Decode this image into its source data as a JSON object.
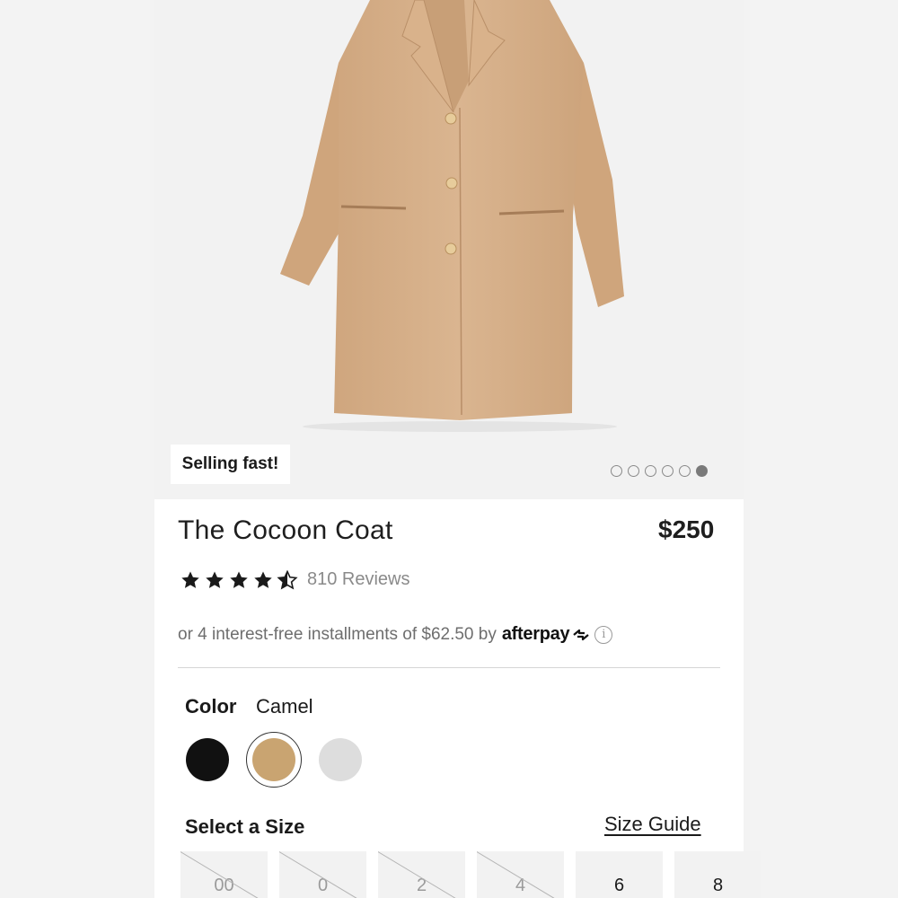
{
  "product": {
    "badge": "Selling fast!",
    "title": "The Cocoon Coat",
    "price": "$250",
    "rating": {
      "value": 4.5,
      "max": 5,
      "reviews_label": "810 Reviews"
    },
    "installments": {
      "text": "or 4 interest-free installments of $62.50 by",
      "provider": "afterpay",
      "info_icon": "info-icon"
    },
    "carousel": {
      "total": 6,
      "active_index": 5
    }
  },
  "color": {
    "label": "Color",
    "selected": "Camel",
    "swatches": [
      {
        "name": "Black",
        "hex": "#111111"
      },
      {
        "name": "Camel",
        "hex": "#c9a471"
      },
      {
        "name": "Grey",
        "hex": "#dddddd"
      }
    ]
  },
  "size": {
    "label": "Select a Size",
    "guide_label": "Size Guide",
    "options": [
      {
        "label": "00",
        "available": false
      },
      {
        "label": "0",
        "available": false
      },
      {
        "label": "2",
        "available": false
      },
      {
        "label": "4",
        "available": false
      },
      {
        "label": "6",
        "available": true
      },
      {
        "label": "8",
        "available": true
      }
    ]
  },
  "colors": {
    "coat": "#d7b08a",
    "star": "#1a1a1a"
  }
}
